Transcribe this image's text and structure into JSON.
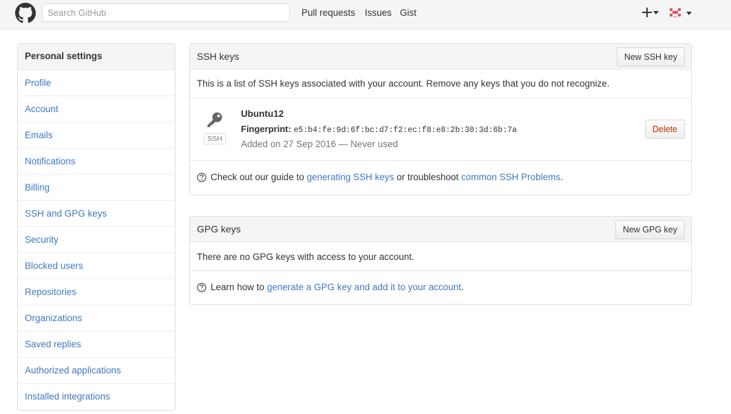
{
  "header": {
    "search_placeholder": "Search GitHub",
    "nav": [
      "Pull requests",
      "Issues",
      "Gist"
    ]
  },
  "sidebar": {
    "title": "Personal settings",
    "items": [
      "Profile",
      "Account",
      "Emails",
      "Notifications",
      "Billing",
      "SSH and GPG keys",
      "Security",
      "Blocked users",
      "Repositories",
      "Organizations",
      "Saved replies",
      "Authorized applications",
      "Installed integrations"
    ]
  },
  "ssh": {
    "title": "SSH keys",
    "new_button": "New SSH key",
    "description": "This is a list of SSH keys associated with your account. Remove any keys that you do not recognize.",
    "key": {
      "label": "SSH",
      "name": "Ubuntu12",
      "fingerprint_label": "Fingerprint:",
      "fingerprint": "e5:b4:fe:9d:6f:bc:d7:f2:ec:f8:e8:2b:30:3d:6b:7a",
      "added": "Added on 27 Sep 2016 — Never used",
      "delete_button": "Delete"
    },
    "help": {
      "prefix": "Check out our guide to",
      "link1": "generating SSH keys",
      "middle": "or troubleshoot",
      "link2": "common SSH Problems",
      "suffix": "."
    }
  },
  "gpg": {
    "title": "GPG keys",
    "new_button": "New GPG key",
    "empty": "There are no GPG keys with access to your account.",
    "help": {
      "prefix": "Learn how to",
      "link": "generate a GPG key and add it to your account",
      "suffix": "."
    }
  },
  "colors": {
    "link": "#4078c0",
    "danger": "#bd2c00",
    "header_bg": "#f5f5f5",
    "avatar": "#e2535f"
  },
  "icons": [
    "github-mark-icon",
    "plus-icon",
    "caret-down-icon",
    "avatar-identicon",
    "key-icon",
    "question-icon"
  ]
}
